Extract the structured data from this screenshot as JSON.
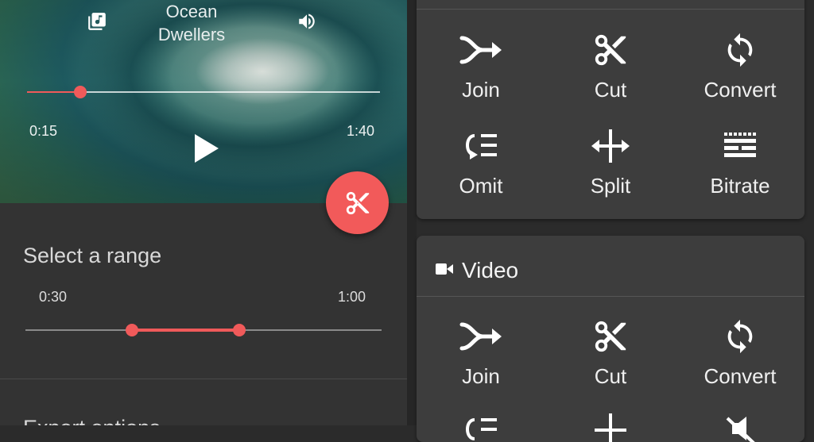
{
  "player": {
    "title_line1": "Ocean",
    "title_line2": "Dwellers",
    "current_time": "0:15",
    "total_time": "1:40",
    "progress_fraction": 0.15
  },
  "range": {
    "label": "Select a range",
    "start_time": "0:30",
    "end_time": "1:00",
    "start_fraction": 0.3,
    "end_fraction": 0.6
  },
  "next_section_label": "Export options",
  "audio_tools": [
    {
      "icon": "join-icon",
      "label": "Join"
    },
    {
      "icon": "scissors-icon",
      "label": "Cut"
    },
    {
      "icon": "convert-icon",
      "label": "Convert"
    },
    {
      "icon": "omit-icon",
      "label": "Omit"
    },
    {
      "icon": "split-icon",
      "label": "Split"
    },
    {
      "icon": "bitrate-icon",
      "label": "Bitrate"
    }
  ],
  "video_card": {
    "title": "Video",
    "tools": [
      {
        "icon": "join-icon",
        "label": "Join"
      },
      {
        "icon": "scissors-icon",
        "label": "Cut"
      },
      {
        "icon": "convert-icon",
        "label": "Convert"
      }
    ]
  },
  "colors": {
    "accent": "#f25a5a",
    "card": "#3d3d3d",
    "panel": "#333333"
  }
}
